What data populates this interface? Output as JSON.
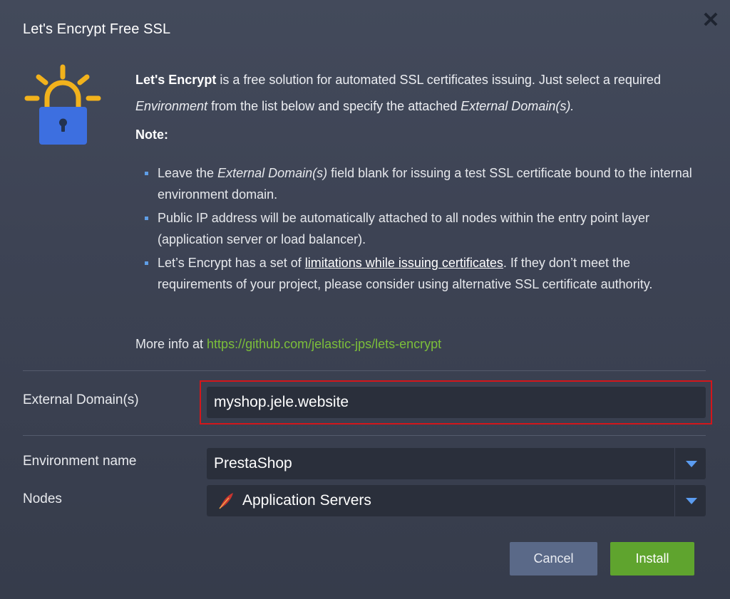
{
  "dialog": {
    "title": "Let's Encrypt Free SSL",
    "close_symbol": "✕"
  },
  "intro": {
    "brand": "Let's Encrypt",
    "text_1": " is a free solution for automated SSL certificates issuing. Just select a required ",
    "environment_term": "Environment",
    "text_2": " from the list below and specify the attached ",
    "domains_term": "External Domain(s).",
    "note_label": "Note:"
  },
  "bullets": {
    "b1_text_1": "Leave the ",
    "b1_term": "External Domain(s)",
    "b1_text_2": " field blank for issuing a test SSL certificate bound to the internal environment domain.",
    "b2_text": "Public IP address will be automatically attached to all nodes within the entry point layer (application server or load balancer).",
    "b3_text_1": "Let’s Encrypt has a set of ",
    "b3_link": "limitations while issuing certificates",
    "b3_text_2": ". If they don’t meet the requirements of your project, please consider using alternative SSL certificate authority."
  },
  "more_info": {
    "prefix": "More info at ",
    "url": "https://github.com/jelastic-jps/lets-encrypt"
  },
  "form": {
    "external_domains_label": "External Domain(s)",
    "external_domains_value": "myshop.jele.website",
    "environment_label": "Environment name",
    "environment_value": "PrestaShop",
    "nodes_label": "Nodes",
    "nodes_value": "Application Servers"
  },
  "buttons": {
    "cancel": "Cancel",
    "install": "Install"
  },
  "icons": {
    "logo": "lets-encrypt-lock-logo",
    "close": "close-icon",
    "node": "feather-icon",
    "dropdown": "chevron-down-icon"
  },
  "colors": {
    "accent_blue": "#5b9cf0",
    "link_green": "#7cbf3a",
    "install_green": "#5fa42e",
    "cancel_blue": "#5a6988",
    "highlight_red": "#d3161b"
  }
}
